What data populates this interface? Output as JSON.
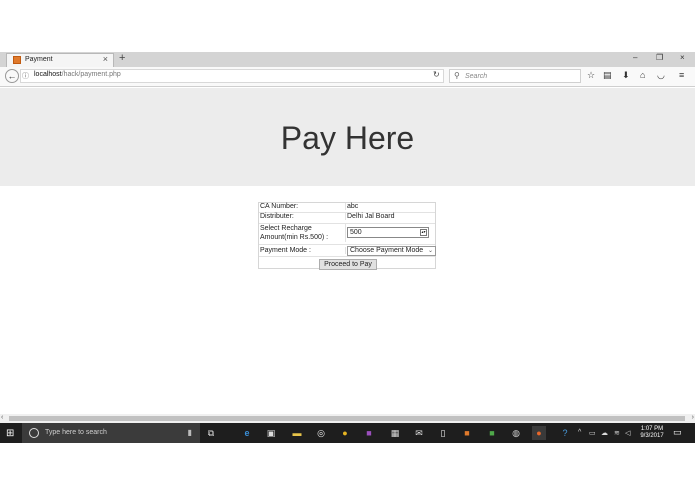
{
  "browser": {
    "tab_title": "Payment",
    "new_tab": "+",
    "tab_close": "×",
    "window_controls": {
      "minimize": "–",
      "restore": "❐",
      "close": "×"
    },
    "url_host": "localhost",
    "url_path": "/hack/payment.php",
    "search_placeholder": "Search"
  },
  "page": {
    "heading": "Pay Here",
    "form": {
      "ca_number_label": "CA Number:",
      "ca_number_value": "abc",
      "distributer_label": "Distributer:",
      "distributer_value": "Delhi Jal Board",
      "amount_label": "Select Recharge Amount(min Rs.500) :",
      "amount_value": "500",
      "payment_mode_label": "Payment Mode :",
      "payment_mode_selected": "Choose Payment Mode",
      "proceed_label": "Proceed to Pay"
    }
  },
  "taskbar": {
    "search_placeholder": "Type here to search",
    "time": "1:07 PM",
    "date": "9/3/2017"
  },
  "icons": [
    "back-icon",
    "info-icon",
    "reload-icon",
    "search-icon",
    "star-icon",
    "clipboard-icon",
    "download-icon",
    "home-icon",
    "pocket-icon",
    "menu-icon",
    "windows-start-icon"
  ]
}
